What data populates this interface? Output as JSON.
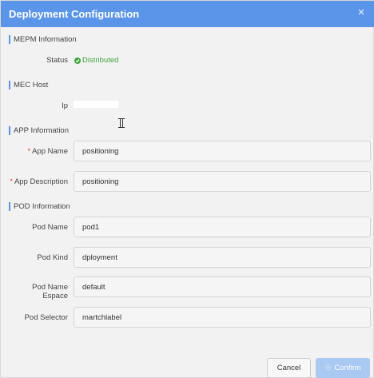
{
  "dialog": {
    "title": "Deployment Configuration",
    "close_glyph": "×"
  },
  "sections": {
    "mepm": "MEPM Information",
    "mec_host": "MEC Host",
    "app": "APP Information",
    "pod": "POD Information"
  },
  "mepm": {
    "status_label": "Status",
    "status_value": "Distributed",
    "status_color": "#3fa33f"
  },
  "mec_host": {
    "ip_label": "Ip"
  },
  "app": {
    "name_label": "App Name",
    "name_value": "positioning",
    "description_label": "App Description",
    "description_value": "positioning",
    "required_mark": "*"
  },
  "pod": {
    "name_label": "Pod Name",
    "name_value": "pod1",
    "kind_label": "Pod Kind",
    "kind_value": "dployment",
    "namespace_label": "Pod Name Espace",
    "namespace_value": "default",
    "selector_label": "Pod Selector",
    "selector_value": "martchlabel"
  },
  "footer": {
    "cancel_label": "Cancel",
    "confirm_label": "Confirm",
    "confirm_icon": "loading-icon"
  },
  "colors": {
    "header": "#5b95ea",
    "confirm_disabled": "#a9c8f2"
  }
}
